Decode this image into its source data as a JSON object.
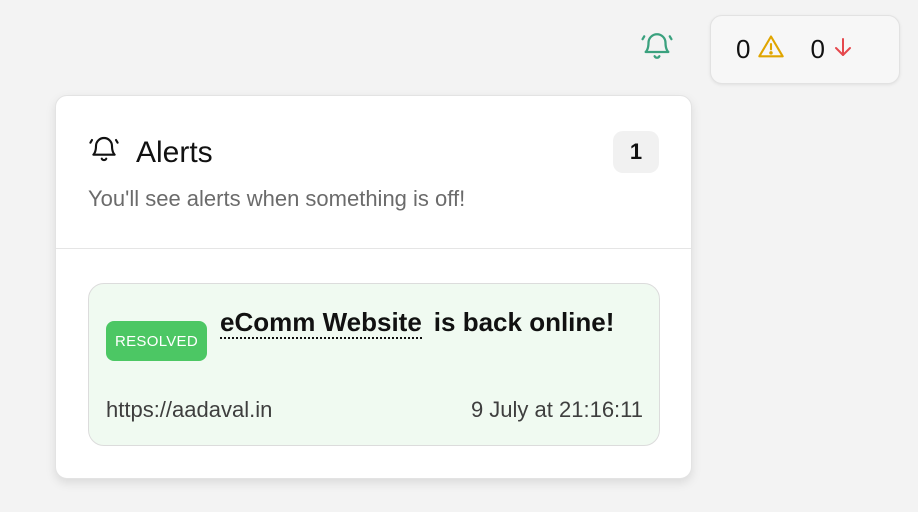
{
  "topbar": {
    "bell_icon": "bell-icon",
    "bell_color": "#3aa17e"
  },
  "status": {
    "warnings": {
      "count": "0",
      "icon": "warning-triangle-icon",
      "color": "#e0a500"
    },
    "down": {
      "count": "0",
      "icon": "arrow-down-icon",
      "color": "#e5484d"
    }
  },
  "alerts_panel": {
    "title": "Alerts",
    "count": "1",
    "subtitle": "You'll see alerts when something is off!",
    "items": [
      {
        "badge": "RESOLVED",
        "badge_color": "#4cc764",
        "monitor_name": "eComm Website",
        "message": "is back online!",
        "url": "https://aadaval.in",
        "time": "9 July at 21:16:11",
        "background": "#f0faf1"
      }
    ]
  }
}
